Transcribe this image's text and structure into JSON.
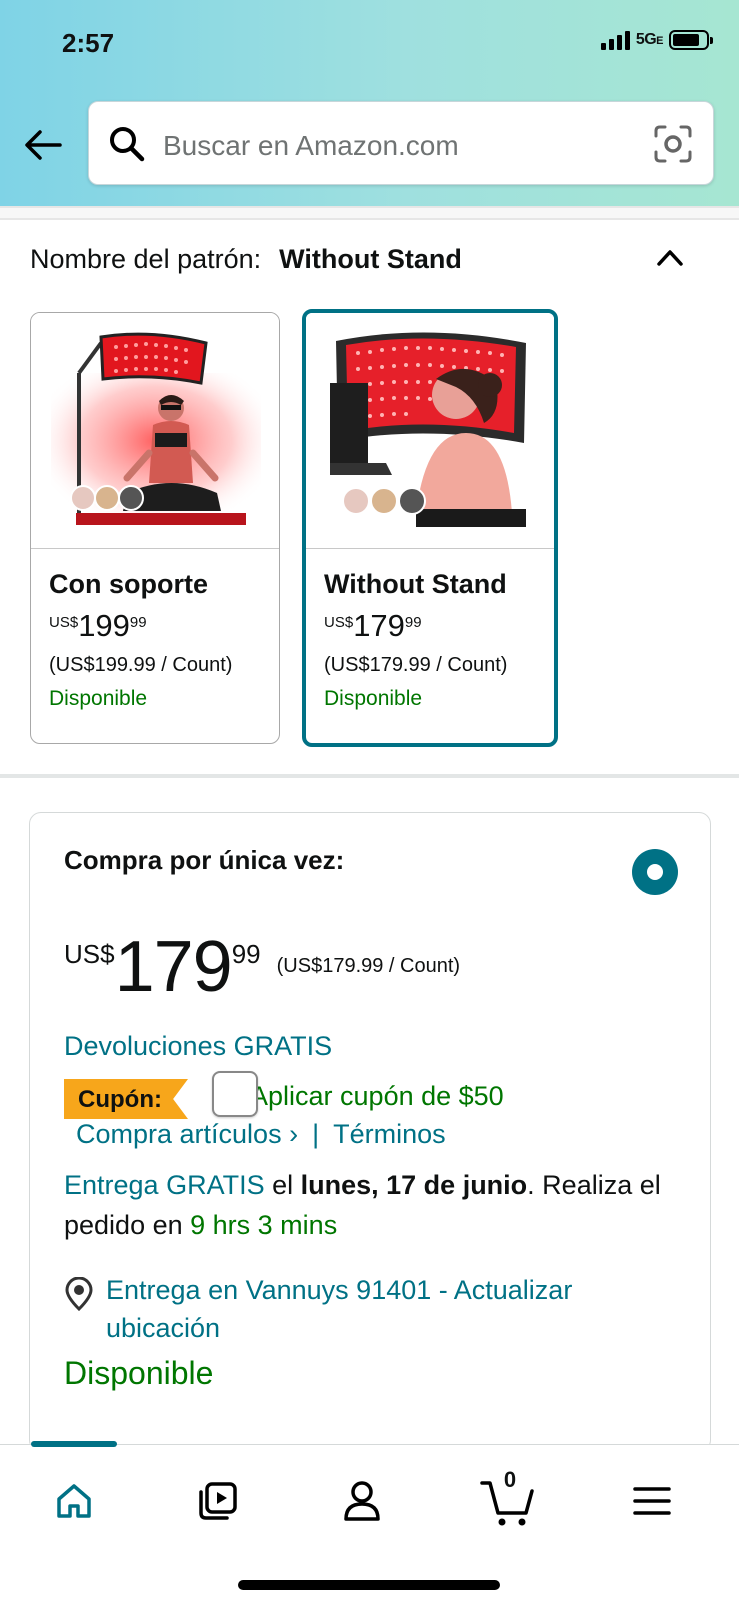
{
  "status_bar": {
    "time": "2:57",
    "network": "5G",
    "network_suffix": "E",
    "battery_level": 0.8
  },
  "header": {
    "back_icon": "arrow-left-icon",
    "search_placeholder": "Buscar en Amazon.com",
    "camera_icon": "camera-scan-icon"
  },
  "pattern": {
    "label": "Nombre del patrón:",
    "selected": "Without Stand",
    "collapse_icon": "chevron-up-icon",
    "options": [
      {
        "title": "Con soporte",
        "currency": "US$",
        "whole": "199",
        "fraction": "99",
        "unit_price": "(US$199.99 / Count)",
        "availability": "Disponible",
        "selected": false
      },
      {
        "title": "Without Stand",
        "currency": "US$",
        "whole": "179",
        "fraction": "99",
        "unit_price": "(US$179.99 / Count)",
        "availability": "Disponible",
        "selected": true
      }
    ]
  },
  "buybox": {
    "purchase_type": "Compra por única vez:",
    "currency": "US$",
    "whole": "179",
    "fraction": "99",
    "unit_price": "(US$179.99 / Count)",
    "returns": "Devoluciones GRATIS",
    "coupon_tag": "Cupón:",
    "coupon_text": "Aplicar cupón de $50",
    "shop_items_link": "Compra artículos ›",
    "links_separator": "|",
    "terms_link": "Términos",
    "delivery_link": "Entrega GRATIS",
    "delivery_pre": "el",
    "delivery_date": "lunes, 17 de junio",
    "delivery_post": ". Realiza el pedido en",
    "delivery_countdown": "9 hrs 3 mins",
    "location_text": "Entrega en Vannuys 91401 - Actualizar ubicación",
    "stock": "Disponible"
  },
  "bottom_nav": {
    "items": [
      "home-icon",
      "video-icon",
      "account-icon",
      "cart-icon",
      "menu-icon"
    ],
    "cart_count": "0",
    "accent": "#007185"
  },
  "colors": {
    "link": "#007185",
    "available": "#007600",
    "coupon": "#f7a61b"
  }
}
